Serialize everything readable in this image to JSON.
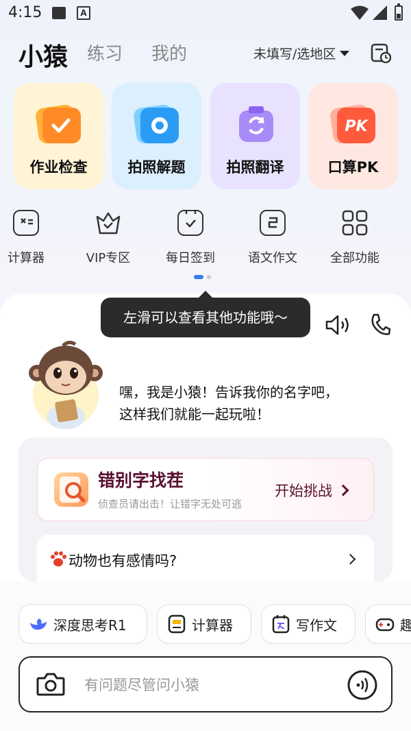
{
  "status": {
    "time": "4:15",
    "notif_icons": [
      "image-icon",
      "a-icon"
    ],
    "right_icons": [
      "wifi-icon",
      "signal-icon",
      "battery-icon"
    ]
  },
  "header": {
    "tabs": [
      "小猿",
      "练习",
      "我的"
    ],
    "active_tab": "小猿",
    "region": "未填写/选地区",
    "history_icon": "history-icon"
  },
  "cards": [
    {
      "label": "作业检查",
      "icon": "homework-check-icon",
      "color": "#ff8a26"
    },
    {
      "label": "拍照解题",
      "icon": "camera-solve-icon",
      "color": "#2a9cf5"
    },
    {
      "label": "拍照翻译",
      "icon": "photo-translate-icon",
      "color": "#8b64f0"
    },
    {
      "label": "口算PK",
      "icon": "pk-icon",
      "color": "#ff5a3c"
    }
  ],
  "tools": [
    {
      "label": "计算器",
      "icon": "calculator-icon"
    },
    {
      "label": "VIP专区",
      "icon": "vip-icon"
    },
    {
      "label": "每日签到",
      "icon": "calendar-check-icon"
    },
    {
      "label": "语文作文",
      "icon": "composition-icon"
    },
    {
      "label": "全部功能",
      "icon": "grid-icon"
    }
  ],
  "tooltip": "左滑可以查看其他功能哦～",
  "greeting": {
    "line1": "嘿，我是小猿！告诉我你的名字吧，",
    "line2": "这样我们就能一起玩啦！"
  },
  "challenge": {
    "title": "错别字找茬",
    "subtitle": "侦查员请出击！让错字无处可逃",
    "action": "开始挑战"
  },
  "topic": {
    "text": "动物也有感情吗?"
  },
  "chips": [
    {
      "label": "深度思考R1",
      "icon": "deepseek-whale-icon"
    },
    {
      "label": "计算器",
      "icon": "calculator-icon"
    },
    {
      "label": "写作文",
      "icon": "write-icon"
    },
    {
      "label": "趣",
      "icon": "game-icon"
    }
  ],
  "input": {
    "placeholder": "有问题尽管问小猿"
  },
  "accent": "#3b7bea"
}
